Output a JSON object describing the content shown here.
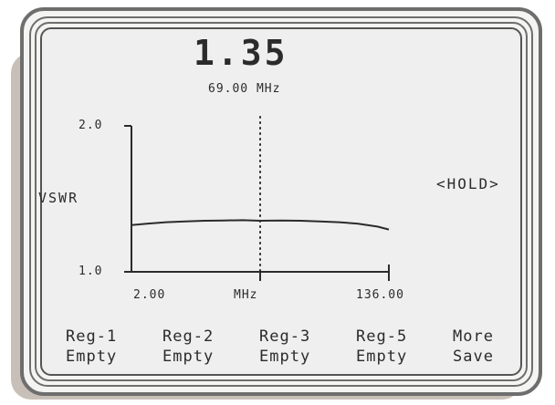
{
  "display": {
    "reading": "1.35",
    "frequency": "69.00 MHz",
    "status": "<HOLD>",
    "y_axis_label": "VSWR"
  },
  "softkeys": [
    {
      "line1": "Reg-1",
      "line2": "Empty"
    },
    {
      "line1": "Reg-2",
      "line2": "Empty"
    },
    {
      "line1": "Reg-3",
      "line2": "Empty"
    },
    {
      "line1": "Reg-5",
      "line2": "Empty"
    },
    {
      "line1": "More",
      "line2": "Save"
    }
  ],
  "chart_data": {
    "type": "line",
    "ylabel": "VSWR",
    "xlabel": "MHz",
    "x_tick_labels": [
      "2.00",
      "MHz",
      "136.00"
    ],
    "y_tick_labels": [
      "2.0",
      "1.0"
    ],
    "xlim": [
      2.0,
      136.0
    ],
    "ylim": [
      1.0,
      2.0
    ],
    "marker_x": 69.0,
    "x": [
      2,
      10,
      20,
      30,
      40,
      50,
      60,
      69,
      80,
      90,
      100,
      110,
      120,
      130,
      136
    ],
    "y": [
      1.32,
      1.33,
      1.34,
      1.345,
      1.35,
      1.352,
      1.354,
      1.35,
      1.352,
      1.35,
      1.345,
      1.34,
      1.33,
      1.31,
      1.29
    ],
    "grid": false
  }
}
